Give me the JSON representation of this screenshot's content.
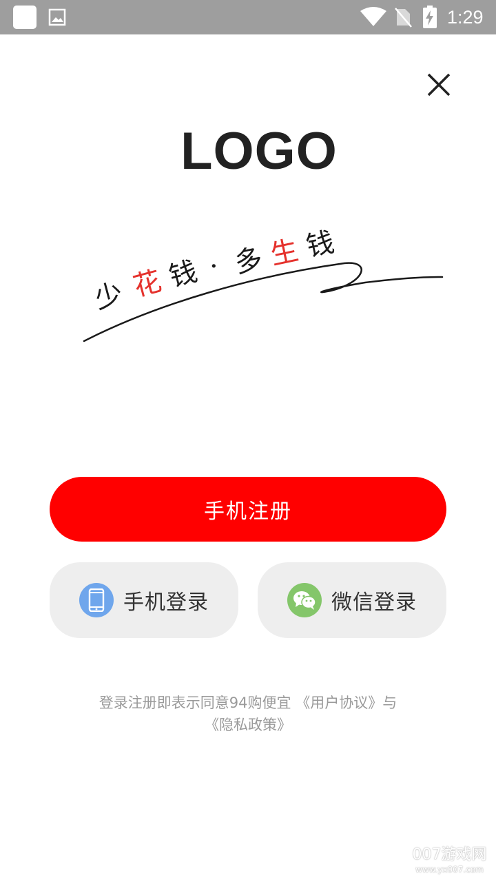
{
  "status_bar": {
    "time": "1:29",
    "icons": [
      "notification-square-icon",
      "gallery-icon",
      "wifi-icon",
      "no-sim-icon",
      "battery-charging-icon"
    ]
  },
  "header": {
    "close_icon": "close-icon",
    "logo_text": "LOGO"
  },
  "slogan": {
    "chars": [
      "少",
      "花",
      "钱",
      "·",
      "多",
      "生",
      "钱"
    ],
    "accent_color": "#e5322d",
    "ink_color": "#1a1a1a"
  },
  "actions": {
    "register_label": "手机注册",
    "register_color": "#ff0000",
    "phone_login_label": "手机登录",
    "phone_login_icon": "phone-icon",
    "wechat_login_label": "微信登录",
    "wechat_login_icon": "wechat-icon"
  },
  "agreement": {
    "prefix": "登录注册即表示同意94购便宜 ",
    "user_agreement": "《用户协议》",
    "joiner": "与",
    "privacy_policy": "《隐私政策》"
  },
  "watermark": {
    "main": "007游戏网",
    "url": "www.yx007.com"
  }
}
